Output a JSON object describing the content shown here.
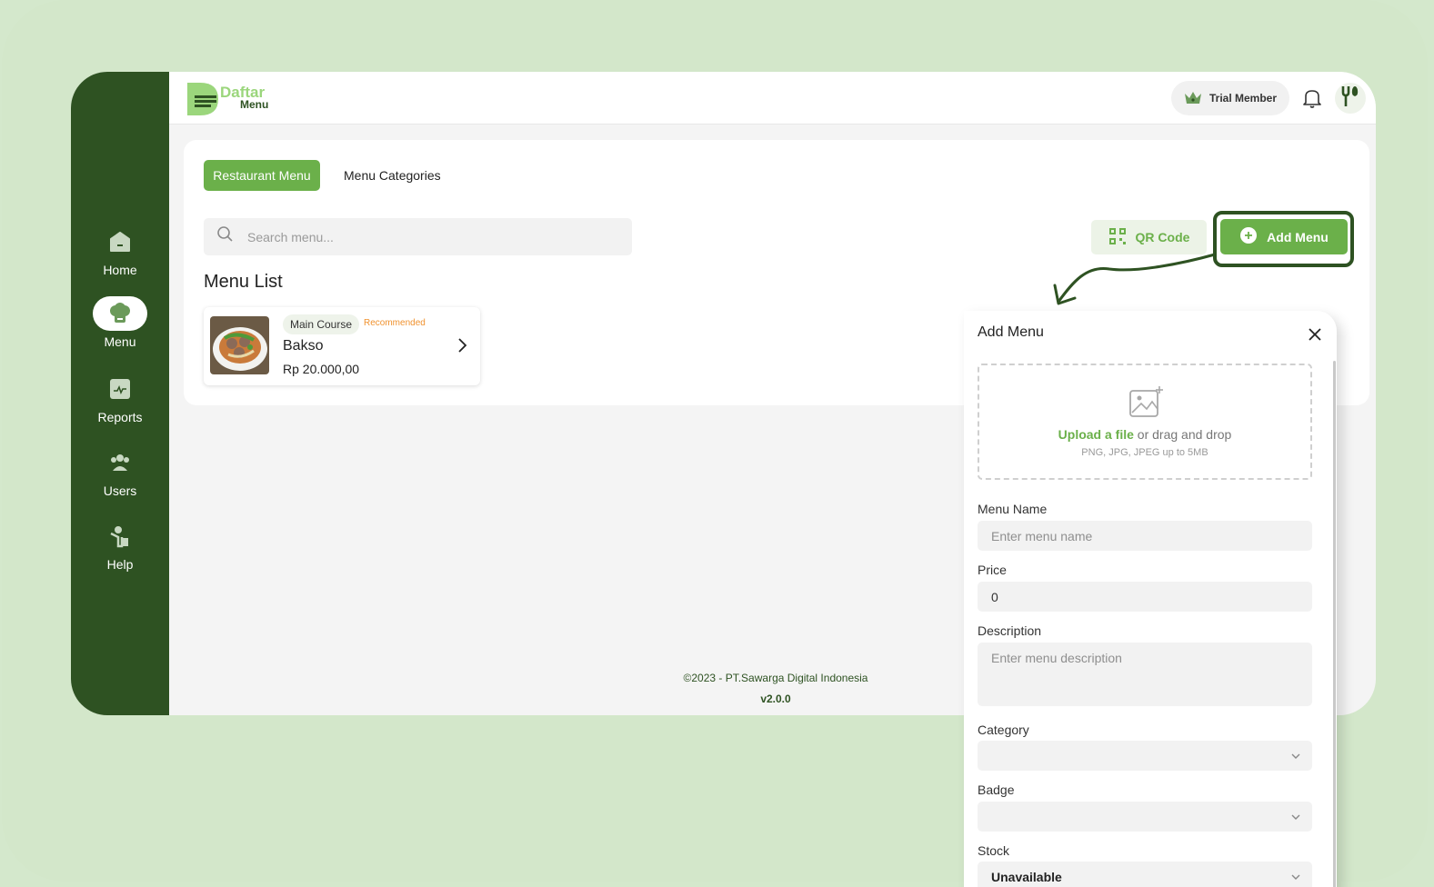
{
  "sidebar": {
    "items": [
      {
        "label": "Home",
        "icon": "home-icon"
      },
      {
        "label": "Menu",
        "icon": "chef-hat-icon",
        "active": true
      },
      {
        "label": "Reports",
        "icon": "reports-icon"
      },
      {
        "label": "Users",
        "icon": "users-icon"
      },
      {
        "label": "Help",
        "icon": "help-icon"
      }
    ]
  },
  "header": {
    "logo_line1": "Daftar",
    "logo_line2": "Menu",
    "membership": "Trial Member"
  },
  "tabs": {
    "active": "Restaurant Menu",
    "other": "Menu Categories"
  },
  "search": {
    "placeholder": "Search menu..."
  },
  "actions": {
    "qr_code": "QR Code",
    "add_menu": "Add Menu"
  },
  "menu_list": {
    "title": "Menu List",
    "items": [
      {
        "category": "Main Course",
        "badge": "Recommended",
        "name": "Bakso",
        "price": "Rp 20.000,00"
      }
    ]
  },
  "footer": {
    "copyright": "©2023 - PT.Sawarga Digital Indonesia",
    "version": "v2.0.0"
  },
  "panel": {
    "title": "Add Menu",
    "upload_link": "Upload a file",
    "upload_text": "or drag and drop",
    "upload_hint": "PNG, JPG, JPEG up to 5MB",
    "menu_name_label": "Menu Name",
    "menu_name_placeholder": "Enter menu name",
    "price_label": "Price",
    "price_value": "0",
    "description_label": "Description",
    "description_placeholder": "Enter menu description",
    "category_label": "Category",
    "category_value": "",
    "badge_label": "Badge",
    "badge_value": "",
    "stock_label": "Stock",
    "stock_value": "Unavailable"
  },
  "colors": {
    "sidebar": "#2e5222",
    "accent": "#6bb04a",
    "background": "#d3e7ca",
    "recommended": "#f0922f"
  }
}
